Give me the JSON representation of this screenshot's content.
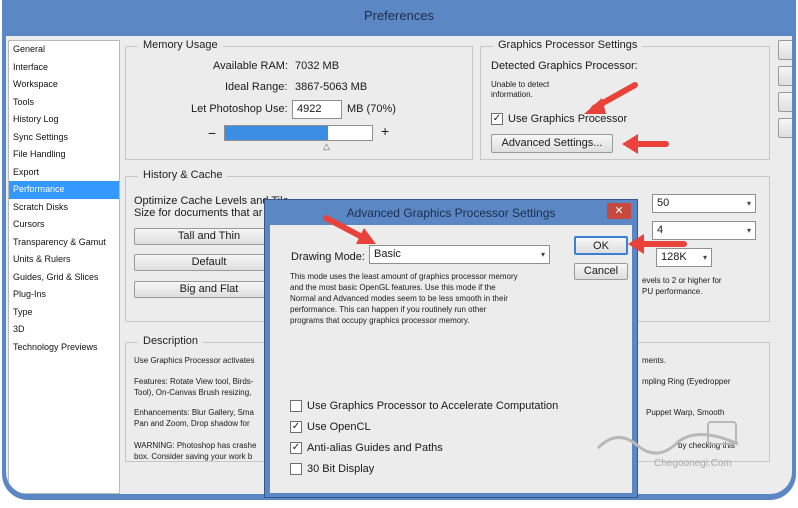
{
  "window": {
    "title": "Preferences"
  },
  "sidebar": {
    "items": [
      {
        "label": "General",
        "active": false
      },
      {
        "label": "Interface",
        "active": false
      },
      {
        "label": "Workspace",
        "active": false
      },
      {
        "label": "Tools",
        "active": false
      },
      {
        "label": "History Log",
        "active": false
      },
      {
        "label": "Sync Settings",
        "active": false
      },
      {
        "label": "File Handling",
        "active": false
      },
      {
        "label": "Export",
        "active": false
      },
      {
        "label": "Performance",
        "active": true
      },
      {
        "label": "Scratch Disks",
        "active": false
      },
      {
        "label": "Cursors",
        "active": false
      },
      {
        "label": "Transparency & Gamut",
        "active": false
      },
      {
        "label": "Units & Rulers",
        "active": false
      },
      {
        "label": "Guides, Grid & Slices",
        "active": false
      },
      {
        "label": "Plug-Ins",
        "active": false
      },
      {
        "label": "Type",
        "active": false
      },
      {
        "label": "3D",
        "active": false
      },
      {
        "label": "Technology Previews",
        "active": false
      }
    ]
  },
  "memory": {
    "title": "Memory Usage",
    "available_label": "Available RAM:",
    "available_value": "7032 MB",
    "ideal_label": "Ideal Range:",
    "ideal_value": "3867-5063 MB",
    "let_use_label": "Let Photoshop Use:",
    "let_use_value": "4922",
    "let_use_unit": "MB (70%)",
    "slider_fraction": 0.7,
    "minus": "−",
    "plus": "+"
  },
  "gpu": {
    "title": "Graphics Processor Settings",
    "detected_label": "Detected Graphics Processor:",
    "detect_msg": "Unable to detect information.",
    "use_gpu_label": "Use Graphics Processor",
    "use_gpu_checked": true,
    "advanced_button": "Advanced Settings..."
  },
  "history": {
    "title": "History & Cache",
    "optimize_line1": "Optimize Cache Levels and Tile",
    "optimize_line2": "Size for documents that ar",
    "btn_tall": "Tall and Thin",
    "btn_default": "Default",
    "btn_big": "Big and Flat",
    "history_states_value": "50",
    "cache_levels_value": "4",
    "cache_tile_value": "128K",
    "note_line1": "evels to 2 or higher for",
    "note_line2": "PU performance."
  },
  "description": {
    "title": "Description",
    "p1": "Use Graphics Processor activates",
    "p1_tail": "ments.",
    "p2a": "Features: Rotate View tool, Birds-",
    "p2a_tail": "mpling Ring (Eyedropper",
    "p2b": "Tool), On-Canvas Brush resizing,",
    "p3a": "Enhancements: Blur Gallery, Sma",
    "p3a_tail": "Puppet Warp, Smooth",
    "p3b": "Pan and Zoom, Drop shadow for",
    "p4a": "WARNING: Photoshop has crashe",
    "p4a_tail": "by checking this",
    "p4b": "box. Consider saving your work b"
  },
  "modal": {
    "title": "Advanced Graphics Processor Settings",
    "close_glyph": "✕",
    "drawing_mode_label": "Drawing Mode:",
    "drawing_mode_value": "Basic",
    "desc_line1": "This mode uses the least amount of graphics processor memory",
    "desc_line2": "and the most basic OpenGL features.  Use this mode if the",
    "desc_line3": "Normal and Advanced modes seem to be less smooth in their",
    "desc_line4": "performance.  This can happen if you routinely run other",
    "desc_line5": "programs that occupy graphics processor memory.",
    "ok": "OK",
    "cancel": "Cancel",
    "opt_compute": {
      "label": "Use Graphics Processor to Accelerate Computation",
      "checked": false
    },
    "opt_opencl": {
      "label": "Use OpenCL",
      "checked": true
    },
    "opt_antialias": {
      "label": "Anti-alias Guides and Paths",
      "checked": true
    },
    "opt_30bit": {
      "label": "30 Bit Display",
      "checked": false
    }
  },
  "watermark": {
    "text": "Chegoonegi.Com"
  },
  "colors": {
    "frame": "#5b88c4",
    "selection": "#3399ff",
    "slider_fill": "#3b8ee3",
    "arrow": "#e8423a"
  },
  "icons": {
    "check": "✓",
    "dropdown": "▾",
    "slider_thumb": "△"
  }
}
